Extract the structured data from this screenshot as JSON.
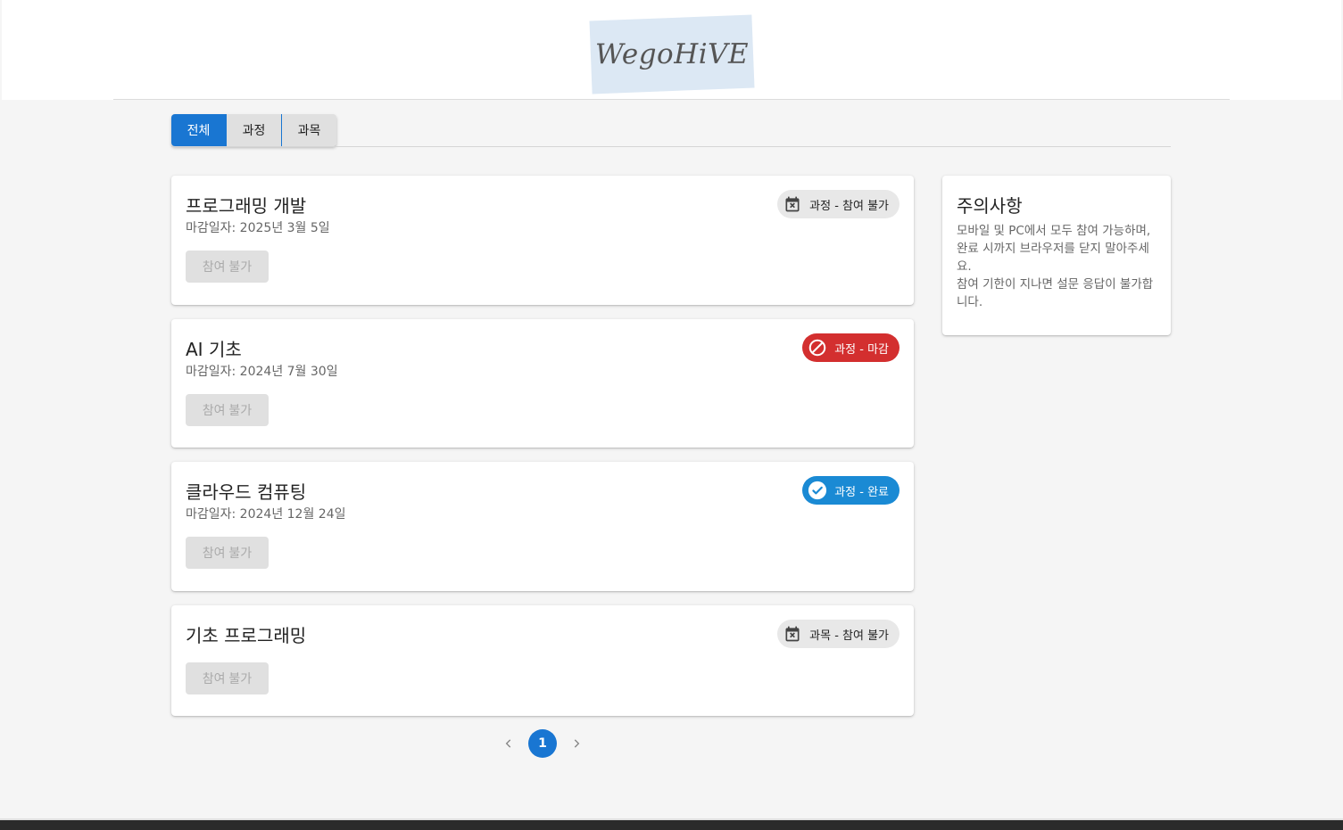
{
  "brand": {
    "logo_text": "WegoHiVE"
  },
  "tabs": [
    {
      "label": "전체",
      "active": true
    },
    {
      "label": "과정",
      "active": false
    },
    {
      "label": "과목",
      "active": false
    }
  ],
  "cards": [
    {
      "title": "프로그래밍 개발",
      "date": "마감일자: 2025년 3월 5일",
      "status": "과정 - 참여 불가",
      "status_icon": "calendar-x-icon",
      "button": "참여 불가"
    },
    {
      "title": "AI 기초",
      "date": "마감일자: 2024년 7월 30일",
      "status": "과정 - 마감",
      "status_icon": "block-icon",
      "button": "참여 불가"
    },
    {
      "title": "클라우드 컴퓨팅",
      "date": "마감일자: 2024년 12월 24일",
      "status": "과정 - 완료",
      "status_icon": "check-circle-icon",
      "button": "참여 불가"
    },
    {
      "title": "기초 프로그래밍",
      "date": "",
      "status": "과목 - 참여 불가",
      "status_icon": "calendar-x-icon",
      "button": "참여 불가"
    }
  ],
  "notice": {
    "title": "주의사항",
    "body": "모바일 및 PC에서 모두 참여 가능하며, 완료 시까지 브라우저를 닫지 말아주세요.\n참여 기한이 지나면 설문 응답이 불가합니다."
  },
  "pagination": {
    "current": "1"
  },
  "colors": {
    "primary": "#1976d2",
    "closed": "#d32f2f",
    "done": "#1a8ad4",
    "chip_gray": "#e8e8e8"
  }
}
